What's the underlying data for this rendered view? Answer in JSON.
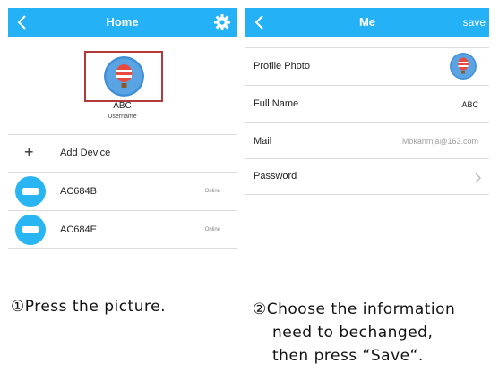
{
  "left_screen": {
    "title": "Home",
    "profile_name": "ABC",
    "profile_sub": "Username",
    "add_device_label": "Add Device",
    "add_device_symbol": "+",
    "devices": [
      {
        "name": "AC684B",
        "status": "Online"
      },
      {
        "name": "AC684E",
        "status": "Online"
      }
    ],
    "icons": [
      "back-icon",
      "gear-icon",
      "air-conditioner-icon"
    ]
  },
  "right_screen": {
    "title": "Me",
    "action_label": "save",
    "rows": [
      {
        "label": "Profile Photo"
      },
      {
        "label": "Full Name",
        "value": "ABC"
      },
      {
        "label": "Mail",
        "value": "Mokanmja@163.com"
      },
      {
        "label": "Password"
      }
    ]
  },
  "captions": {
    "left_num": "①",
    "left_text": "Press the picture.",
    "right_num": "②",
    "right_line1": "Choose the information",
    "right_line2": "need to bechanged,",
    "right_line3": "then press “Save“."
  },
  "colors": {
    "header": "#25b1f5",
    "highlight_border": "#b23a3a",
    "device_icon": "#29b4f2"
  }
}
